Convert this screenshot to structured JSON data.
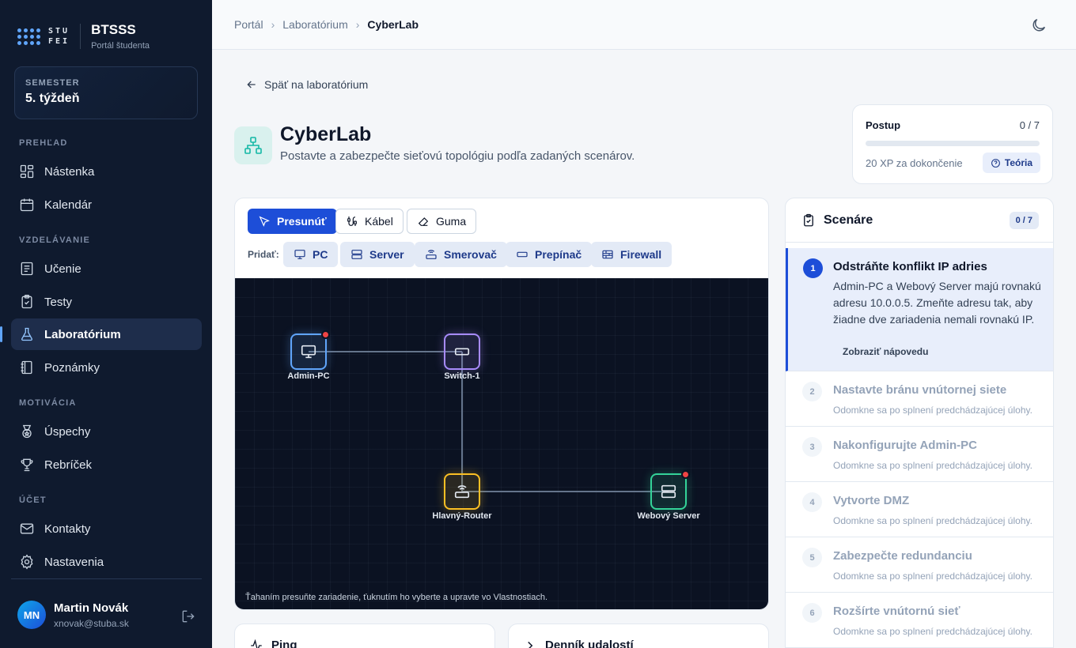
{
  "brand": {
    "logo_line1": "STU",
    "logo_line2": "FEI",
    "title": "BTSSS",
    "subtitle": "Portál študenta"
  },
  "semester": {
    "label": "SEMESTER",
    "value": "5. týždeň"
  },
  "nav": {
    "sections": {
      "overview": "PREHĽAD",
      "education": "VZDELÁVANIE",
      "motivation": "MOTIVÁCIA",
      "account": "ÚČET"
    },
    "items": [
      {
        "label": "Nástenka",
        "icon": "dashboard-icon"
      },
      {
        "label": "Kalendár",
        "icon": "calendar-icon"
      },
      {
        "label": "Učenie",
        "icon": "book-icon"
      },
      {
        "label": "Testy",
        "icon": "clipboard-icon"
      },
      {
        "label": "Laboratórium",
        "icon": "flask-icon",
        "active": true
      },
      {
        "label": "Poznámky",
        "icon": "notebook-icon"
      },
      {
        "label": "Úspechy",
        "icon": "medal-icon"
      },
      {
        "label": "Rebríček",
        "icon": "trophy-icon"
      },
      {
        "label": "Kontakty",
        "icon": "mail-icon"
      },
      {
        "label": "Nastavenia",
        "icon": "gear-icon"
      }
    ]
  },
  "user": {
    "initials": "MN",
    "name": "Martin Novák",
    "email": "xnovak@stuba.sk"
  },
  "breadcrumb": [
    "Portál",
    "Laboratórium",
    "CyberLab"
  ],
  "back_link": "Späť na laboratórium",
  "page": {
    "title": "CyberLab",
    "subtitle": "Postavte a zabezpečte sieťovú topológiu podľa zadaných scenárov."
  },
  "progress": {
    "label": "Postup",
    "value": "0 / 7",
    "fraction": 0,
    "xp": "20 XP za dokončenie",
    "theory_button": "Teória"
  },
  "toolbar": {
    "tools": [
      {
        "label": "Presunúť",
        "icon": "cursor-icon",
        "active": true
      },
      {
        "label": "Kábel",
        "icon": "cable-icon",
        "active": false
      },
      {
        "label": "Guma",
        "icon": "eraser-icon",
        "active": false
      }
    ],
    "add_label": "Pridať:",
    "add_buttons": [
      {
        "label": "PC",
        "icon": "monitor-icon"
      },
      {
        "label": "Server",
        "icon": "server-icon"
      },
      {
        "label": "Smerovač",
        "icon": "router-icon"
      },
      {
        "label": "Prepínač",
        "icon": "switch-icon"
      },
      {
        "label": "Firewall",
        "icon": "firewall-icon"
      }
    ]
  },
  "canvas": {
    "hint": "Ťahaním presuňte zariadenie, ťuknutím ho vyberte a upravte vo Vlastnostiach.",
    "devices": [
      {
        "id": "pc",
        "label": "Admin-PC",
        "type": "pc",
        "color": "#60a5fa",
        "alert": true
      },
      {
        "id": "sw",
        "label": "Switch-1",
        "type": "switch",
        "color": "#a78bfa",
        "alert": false
      },
      {
        "id": "rt",
        "label": "Hlavný-Router",
        "type": "router",
        "color": "#fbbf24",
        "alert": false
      },
      {
        "id": "srv",
        "label": "Webový Server",
        "type": "server",
        "color": "#34d399",
        "alert": true
      }
    ],
    "links": [
      [
        "pc",
        "sw"
      ],
      [
        "sw",
        "rt"
      ],
      [
        "rt",
        "srv"
      ]
    ]
  },
  "bottom_panels": {
    "ping": "Ping",
    "log": "Denník udalostí"
  },
  "scenarios": {
    "title": "Scenáre",
    "count": "0 / 7",
    "hint_link": "Zobraziť nápovedu",
    "locked_text": "Odomkne sa po splnení predchádzajúcej úlohy.",
    "tasks": [
      {
        "num": "1",
        "title": "Odstráňte konflikt IP adries",
        "desc": "Admin-PC a Webový Server majú rovnakú adresu 10.0.0.5. Zmeňte adresu tak, aby žiadne dve zariadenia nemali rovnakú IP."
      },
      {
        "num": "2",
        "title": "Nastavte bránu vnútornej siete"
      },
      {
        "num": "3",
        "title": "Nakonfigurujte Admin-PC"
      },
      {
        "num": "4",
        "title": "Vytvorte DMZ"
      },
      {
        "num": "5",
        "title": "Zabezpečte redundanciu"
      },
      {
        "num": "6",
        "title": "Rozšírte vnútornú sieť"
      }
    ]
  },
  "colors": {
    "accent": "#1d4ed8",
    "sidebar": "#0f1a2e",
    "canvas": "#0b1222",
    "alert": "#ef4444"
  }
}
